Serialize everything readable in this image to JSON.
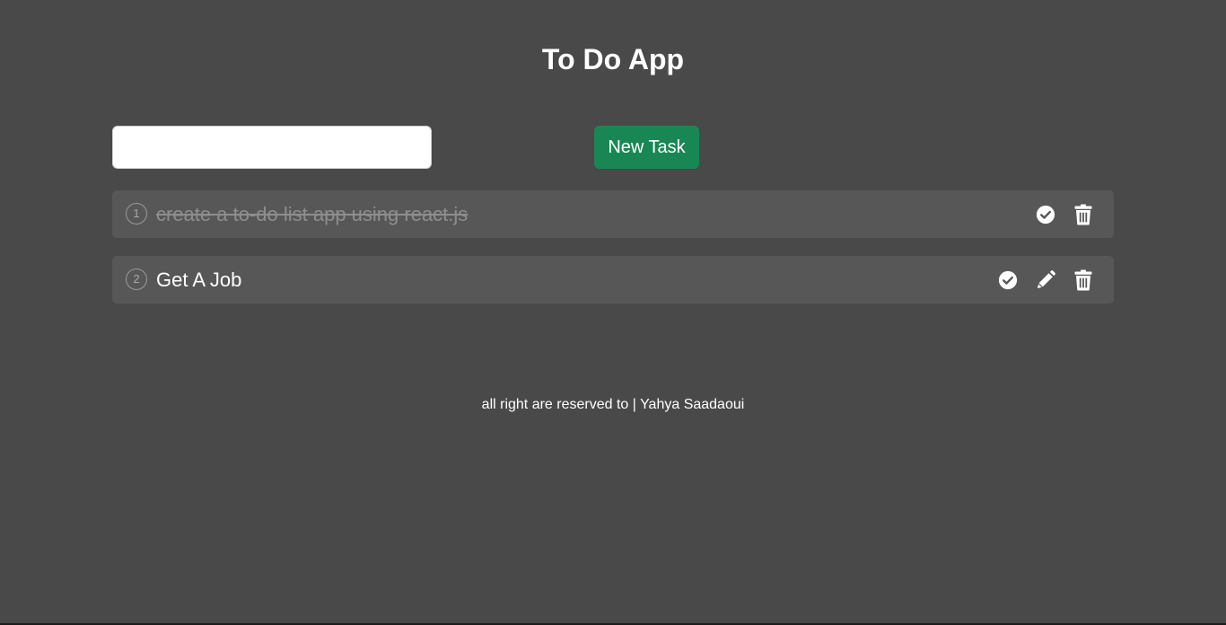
{
  "app": {
    "title": "To Do App"
  },
  "form": {
    "input_value": "",
    "input_placeholder": "",
    "new_task_label": "New Task"
  },
  "tasks": [
    {
      "number": "1",
      "text": "create a to-do list app using react.js",
      "done": true,
      "actions": [
        "check-circle-icon",
        "trash-icon"
      ]
    },
    {
      "number": "2",
      "text": "Get A Job",
      "done": false,
      "actions": [
        "check-circle-icon",
        "pencil-icon",
        "trash-icon"
      ]
    }
  ],
  "footer": {
    "text": "all right are reserved to | Yahya Saadaoui"
  },
  "colors": {
    "background": "#494949",
    "task_row": "#575757",
    "button_green": "#198754",
    "done_text": "#8e8e8e"
  }
}
